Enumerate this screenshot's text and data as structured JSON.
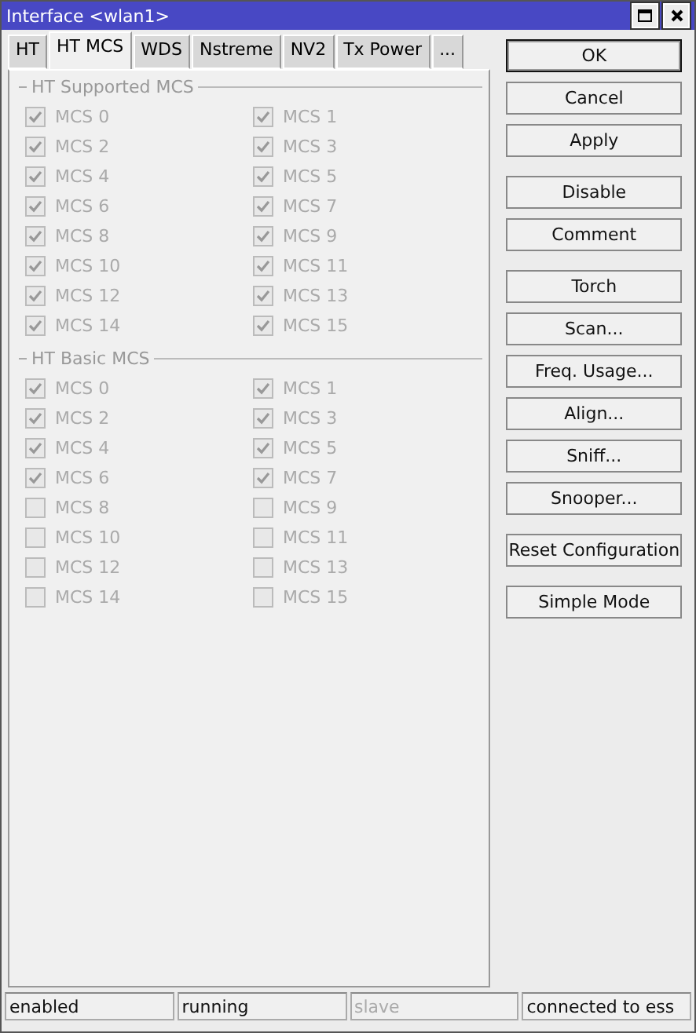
{
  "window": {
    "title": "Interface <wlan1>"
  },
  "tabs": [
    {
      "label": "HT",
      "selected": false
    },
    {
      "label": "HT MCS",
      "selected": true
    },
    {
      "label": "WDS",
      "selected": false
    },
    {
      "label": "Nstreme",
      "selected": false
    },
    {
      "label": "NV2",
      "selected": false
    },
    {
      "label": "Tx Power",
      "selected": false
    },
    {
      "label": "...",
      "selected": false
    }
  ],
  "sections": [
    {
      "title": "HT Supported MCS",
      "items": [
        {
          "label": "MCS 0",
          "checked": true,
          "disabled": true
        },
        {
          "label": "MCS 1",
          "checked": true,
          "disabled": true
        },
        {
          "label": "MCS 2",
          "checked": true,
          "disabled": true
        },
        {
          "label": "MCS 3",
          "checked": true,
          "disabled": true
        },
        {
          "label": "MCS 4",
          "checked": true,
          "disabled": true
        },
        {
          "label": "MCS 5",
          "checked": true,
          "disabled": true
        },
        {
          "label": "MCS 6",
          "checked": true,
          "disabled": true
        },
        {
          "label": "MCS 7",
          "checked": true,
          "disabled": true
        },
        {
          "label": "MCS 8",
          "checked": true,
          "disabled": true
        },
        {
          "label": "MCS 9",
          "checked": true,
          "disabled": true
        },
        {
          "label": "MCS 10",
          "checked": true,
          "disabled": true
        },
        {
          "label": "MCS 11",
          "checked": true,
          "disabled": true
        },
        {
          "label": "MCS 12",
          "checked": true,
          "disabled": true
        },
        {
          "label": "MCS 13",
          "checked": true,
          "disabled": true
        },
        {
          "label": "MCS 14",
          "checked": true,
          "disabled": true
        },
        {
          "label": "MCS 15",
          "checked": true,
          "disabled": true
        }
      ]
    },
    {
      "title": "HT Basic MCS",
      "items": [
        {
          "label": "MCS 0",
          "checked": true,
          "disabled": true
        },
        {
          "label": "MCS 1",
          "checked": true,
          "disabled": true
        },
        {
          "label": "MCS 2",
          "checked": true,
          "disabled": true
        },
        {
          "label": "MCS 3",
          "checked": true,
          "disabled": true
        },
        {
          "label": "MCS 4",
          "checked": true,
          "disabled": true
        },
        {
          "label": "MCS 5",
          "checked": true,
          "disabled": true
        },
        {
          "label": "MCS 6",
          "checked": true,
          "disabled": true
        },
        {
          "label": "MCS 7",
          "checked": true,
          "disabled": true
        },
        {
          "label": "MCS 8",
          "checked": false,
          "disabled": true
        },
        {
          "label": "MCS 9",
          "checked": false,
          "disabled": true
        },
        {
          "label": "MCS 10",
          "checked": false,
          "disabled": true
        },
        {
          "label": "MCS 11",
          "checked": false,
          "disabled": true
        },
        {
          "label": "MCS 12",
          "checked": false,
          "disabled": true
        },
        {
          "label": "MCS 13",
          "checked": false,
          "disabled": true
        },
        {
          "label": "MCS 14",
          "checked": false,
          "disabled": true
        },
        {
          "label": "MCS 15",
          "checked": false,
          "disabled": true
        }
      ]
    }
  ],
  "button_groups": [
    [
      {
        "label": "OK",
        "default": true
      },
      {
        "label": "Cancel",
        "default": false
      },
      {
        "label": "Apply",
        "default": false
      }
    ],
    [
      {
        "label": "Disable",
        "default": false
      },
      {
        "label": "Comment",
        "default": false
      }
    ],
    [
      {
        "label": "Torch",
        "default": false
      },
      {
        "label": "Scan...",
        "default": false
      },
      {
        "label": "Freq. Usage...",
        "default": false
      },
      {
        "label": "Align...",
        "default": false
      },
      {
        "label": "Sniff...",
        "default": false
      },
      {
        "label": "Snooper...",
        "default": false
      }
    ],
    [
      {
        "label": "Reset Configuration",
        "default": false
      }
    ],
    [
      {
        "label": "Simple Mode",
        "default": false
      }
    ]
  ],
  "status_bar": [
    {
      "text": "enabled",
      "disabled": false
    },
    {
      "text": "running",
      "disabled": false
    },
    {
      "text": "slave",
      "disabled": true
    },
    {
      "text": "connected to ess",
      "disabled": false
    }
  ]
}
